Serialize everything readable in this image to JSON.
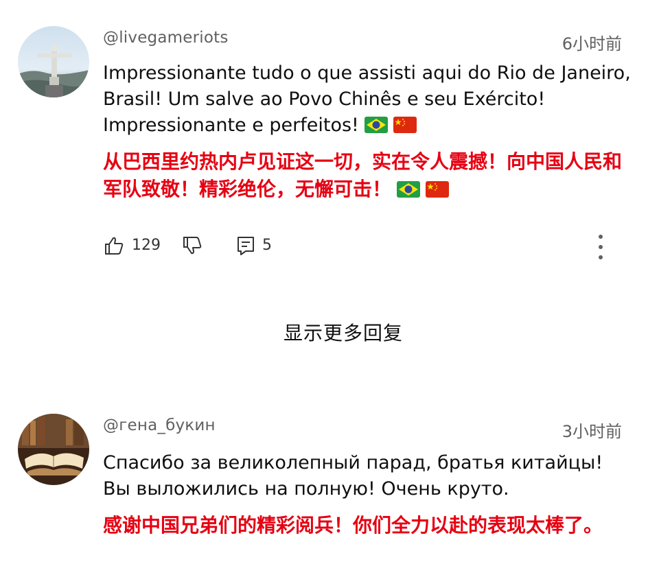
{
  "comments": [
    {
      "username": "@livegameriots",
      "time": "6小时前",
      "text": "Impressionante tudo o que assisti aqui do Rio de Janeiro, Brasil! Um salve ao Povo Chinês e seu Exército! Impressionante e perfeitos!",
      "translation": "从巴西里约热内卢见证这一切，实在令人震撼！向中国人民和军队致敬！精彩绝伦，无懈可击！",
      "likes": "129",
      "replies": "5",
      "flags": [
        "brazil-flag-icon",
        "china-flag-icon"
      ]
    },
    {
      "username": "@гена_букин",
      "time": "3小时前",
      "text": "Спасибо за великолепный парад, братья китайцы! Вы выложились на полную! Очень круто.",
      "translation": "感谢中国兄弟们的精彩阅兵！你们全力以赴的表现太棒了。"
    }
  ],
  "show_more_replies": "显示更多回复",
  "colors": {
    "translation": "#e60012",
    "meta": "#606060"
  }
}
